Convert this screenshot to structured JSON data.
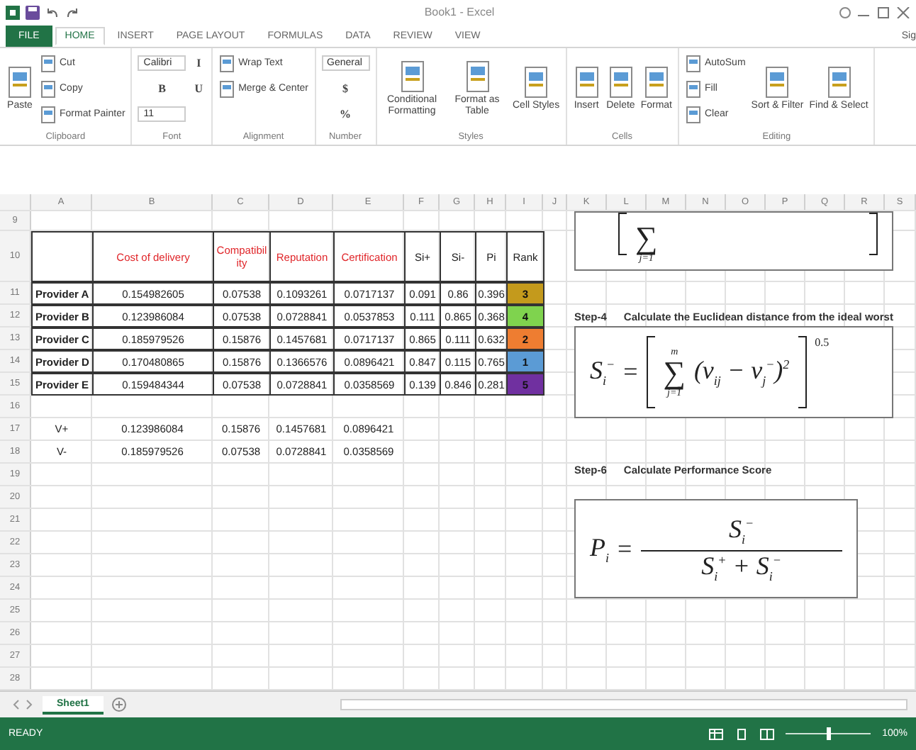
{
  "window": {
    "title": "Book1 - Excel",
    "account": "Sig"
  },
  "ribbon": {
    "tabs": [
      {
        "label": "FILE",
        "selected": false,
        "kind": "file"
      },
      {
        "label": "HOME",
        "selected": true,
        "kind": "tab"
      },
      {
        "label": "INSERT",
        "selected": false,
        "kind": "tab"
      },
      {
        "label": "PAGE LAYOUT",
        "selected": false,
        "kind": "tab"
      },
      {
        "label": "FORMULAS",
        "selected": false,
        "kind": "tab"
      },
      {
        "label": "DATA",
        "selected": false,
        "kind": "tab"
      },
      {
        "label": "REVIEW",
        "selected": false,
        "kind": "tab"
      },
      {
        "label": "VIEW",
        "selected": false,
        "kind": "tab"
      }
    ],
    "groups": [
      {
        "label": "Clipboard",
        "items": [
          {
            "label": "Paste",
            "kind": "large"
          },
          {
            "label": "Cut",
            "kind": "small"
          },
          {
            "label": "Copy",
            "kind": "small"
          },
          {
            "label": "Format Painter",
            "kind": "small"
          }
        ]
      },
      {
        "label": "Font",
        "items": [
          {
            "label": "Calibri",
            "kind": "field"
          },
          {
            "label": "B",
            "kind": "glyph"
          },
          {
            "label": "11",
            "kind": "field"
          },
          {
            "label": "I",
            "kind": "glyph"
          },
          {
            "label": "U",
            "kind": "glyph"
          }
        ]
      },
      {
        "label": "Alignment",
        "items": [
          {
            "label": "Wrap Text",
            "kind": "small"
          },
          {
            "label": "Merge & Center",
            "kind": "small"
          }
        ]
      },
      {
        "label": "Number",
        "items": [
          {
            "label": "General",
            "kind": "field"
          },
          {
            "label": "$",
            "kind": "glyph"
          },
          {
            "label": "%",
            "kind": "glyph"
          }
        ]
      },
      {
        "label": "Styles",
        "items": [
          {
            "label": "Conditional Formatting",
            "kind": "large"
          },
          {
            "label": "Format as Table",
            "kind": "large"
          },
          {
            "label": "Cell Styles",
            "kind": "large"
          }
        ]
      },
      {
        "label": "Cells",
        "items": [
          {
            "label": "Insert",
            "kind": "large"
          },
          {
            "label": "Delete",
            "kind": "large"
          },
          {
            "label": "Format",
            "kind": "large"
          }
        ]
      },
      {
        "label": "Editing",
        "items": [
          {
            "label": "AutoSum",
            "kind": "small"
          },
          {
            "label": "Fill",
            "kind": "small"
          },
          {
            "label": "Clear",
            "kind": "small"
          },
          {
            "label": "Sort & Filter",
            "kind": "large"
          },
          {
            "label": "Find & Select",
            "kind": "large"
          }
        ]
      }
    ]
  },
  "sheet": {
    "column_letters": [
      "A",
      "B",
      "C",
      "D",
      "E",
      "F",
      "G",
      "H",
      "I",
      "J",
      "K",
      "L",
      "M",
      "N",
      "O",
      "P",
      "Q",
      "R",
      "S"
    ],
    "row_numbers": [
      "9",
      "10",
      "11",
      "12",
      "13",
      "14",
      "15",
      "16",
      "17",
      "18",
      "19",
      "20",
      "21",
      "22",
      "23",
      "24",
      "25",
      "26",
      "27",
      "28"
    ],
    "table": {
      "columns": [
        {
          "label": "Cost of delivery",
          "kind": "criterion"
        },
        {
          "label": "Compatibility",
          "kind": "criterion"
        },
        {
          "label": "Reputation",
          "kind": "criterion"
        },
        {
          "label": "Certification",
          "kind": "criterion"
        },
        {
          "label": "Si+",
          "kind": "measure"
        },
        {
          "label": "Si-",
          "kind": "measure"
        },
        {
          "label": "Pi",
          "kind": "measure"
        },
        {
          "label": "Rank",
          "kind": "measure"
        }
      ],
      "rows": [
        {
          "provider": "Provider A",
          "cells": [
            "0.154982605",
            "0.07538",
            "0.1093261",
            "0.0717137",
            "0.091",
            "0.86",
            "0.396"
          ],
          "rank": "3",
          "color": "#c49a1c"
        },
        {
          "provider": "Provider B",
          "cells": [
            "0.123986084",
            "0.07538",
            "0.0728841",
            "0.0537853",
            "0.111",
            "0.865",
            "0.368"
          ],
          "rank": "4",
          "color": "#7fd34e"
        },
        {
          "provider": "Provider C",
          "cells": [
            "0.185979526",
            "0.15876",
            "0.1457681",
            "0.0717137",
            "0.865",
            "0.111",
            "0.632"
          ],
          "rank": "2",
          "color": "#ee7d31"
        },
        {
          "provider": "Provider D",
          "cells": [
            "0.170480865",
            "0.15876",
            "0.1366576",
            "0.0896421",
            "0.847",
            "0.115",
            "0.765"
          ],
          "rank": "1",
          "color": "#5b9bd5"
        },
        {
          "provider": "Provider E",
          "cells": [
            "0.159484344",
            "0.07538",
            "0.0728841",
            "0.0358569",
            "0.139",
            "0.846",
            "0.281"
          ],
          "rank": "5",
          "color": "#7030a0"
        }
      ]
    },
    "ideal": [
      {
        "label": "V+",
        "cells": [
          "0.123986084",
          "0.15876",
          "0.1457681",
          "0.0896421"
        ]
      },
      {
        "label": "V-",
        "cells": [
          "0.185979526",
          "0.07538",
          "0.0728841",
          "0.0358569"
        ]
      }
    ],
    "partial_formula": {
      "operator": "∑",
      "lower": "j=1"
    },
    "steps": [
      {
        "step": "Step-4",
        "text": "Calculate the Euclidean distance from the ideal worst",
        "formula": {
          "kind": "sum",
          "lhs": "S$_{i}$$^{−}$",
          "equals": "=",
          "operator": "∑",
          "upper": "m",
          "lower": "j=1",
          "term": "(v$_{ij}$ − v$_{j}$$^{−}$)$^{2}$",
          "exponent": "0.5"
        }
      },
      {
        "step": "Step-6",
        "text": "Calculate Performance Score",
        "formula": {
          "kind": "fraction",
          "lhs": "P$_{i}$",
          "equals": "=",
          "numerator": "S$_{i}$$^{−}$",
          "denominator": "S$_{i}$$^{+}$ + S$_{i}$$^{−}$"
        }
      }
    ]
  },
  "sheet_tabs": [
    {
      "label": "Sheet1",
      "selected": true
    }
  ],
  "status": {
    "text": "READY",
    "zoom": "100%",
    "level": 0.5
  }
}
